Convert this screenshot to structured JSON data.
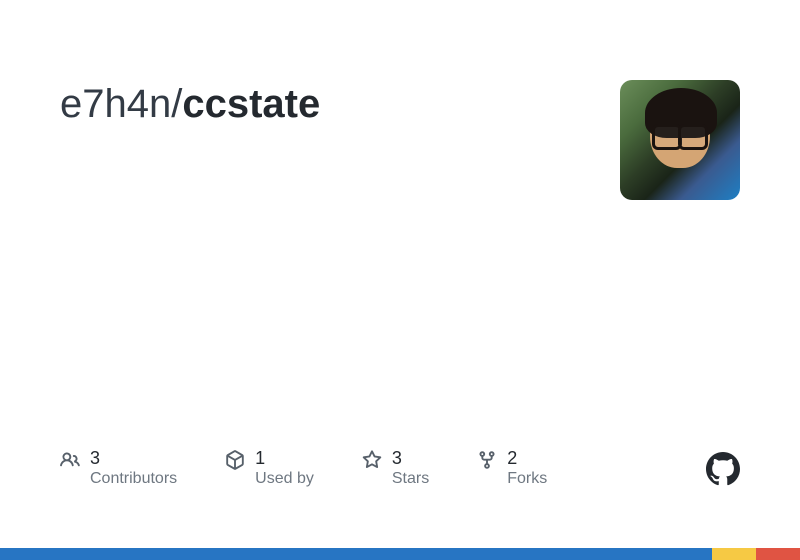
{
  "repo": {
    "owner": "e7h4n",
    "separator": "/",
    "name": "ccstate"
  },
  "stats": {
    "contributors": {
      "value": "3",
      "label": "Contributors"
    },
    "usedby": {
      "value": "1",
      "label": "Used by"
    },
    "stars": {
      "value": "3",
      "label": "Stars"
    },
    "forks": {
      "value": "2",
      "label": "Forks"
    }
  },
  "colors": {
    "bar": [
      "#2775c3",
      "#2775c3",
      "#f6c944",
      "#e05443"
    ],
    "bar_widths": [
      "89%",
      "0%",
      "5.5%",
      "5.5%"
    ]
  }
}
